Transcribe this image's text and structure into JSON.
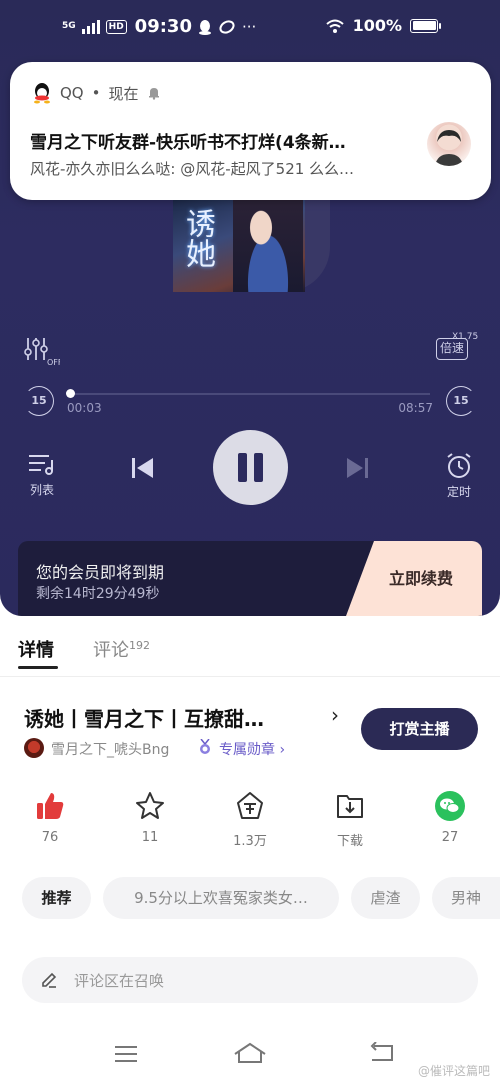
{
  "status_bar": {
    "network": "5G",
    "hd": "HD",
    "time": "09:30",
    "battery": "100%"
  },
  "notification": {
    "app_name": "QQ",
    "separator": "•",
    "when": "现在",
    "title": "雪月之下听友群-快乐听书不打烊(4条新…",
    "body": "风花-亦久亦旧么么哒: @风花-起风了521  么么…"
  },
  "player": {
    "cover_title": "诱她",
    "speed_label": "倍速",
    "speed_value": "X1.75",
    "skip_back": "15",
    "skip_forward": "15",
    "progress": 0.006,
    "time_current": "00:03",
    "time_total": "08:57",
    "playlist_label": "列表",
    "timer_label": "定时"
  },
  "vip_banner": {
    "title": "您的会员即将到期",
    "subtitle": "剩余14时29分49秒",
    "cta": "立即续费"
  },
  "tabs": [
    {
      "label": "详情"
    },
    {
      "label": "评论",
      "count": "192"
    }
  ],
  "album": {
    "title": "诱她丨雪月之下丨互撩甜…",
    "arrow": "›",
    "tip_button": "打赏主播",
    "anchor_name": "雪月之下_唬头Bng",
    "badge": "专属勋章 ›"
  },
  "actions": [
    {
      "icon": "thumbs-up-icon",
      "label": "76"
    },
    {
      "icon": "star-icon",
      "label": "11"
    },
    {
      "icon": "gift-coin-icon",
      "label": "1.3万"
    },
    {
      "icon": "download-icon",
      "label": "下载"
    },
    {
      "icon": "wechat-icon",
      "label": "27"
    }
  ],
  "chips": [
    "推荐",
    "9.5分以上欢喜冤家类女…",
    "虐渣",
    "男神"
  ],
  "comment": {
    "placeholder": "评论区在召唤"
  },
  "watermark": "@催评这篇吧",
  "colors": {
    "player_bg": "#2c2b5e",
    "vip_bg": "#1e1d3c",
    "vip_cta_bg": "#fde2d6",
    "tip_button_bg": "#2b2a55",
    "like_red": "#e23b3b",
    "wechat_green": "#2bc15d",
    "badge_purple": "#6a5cc8"
  }
}
